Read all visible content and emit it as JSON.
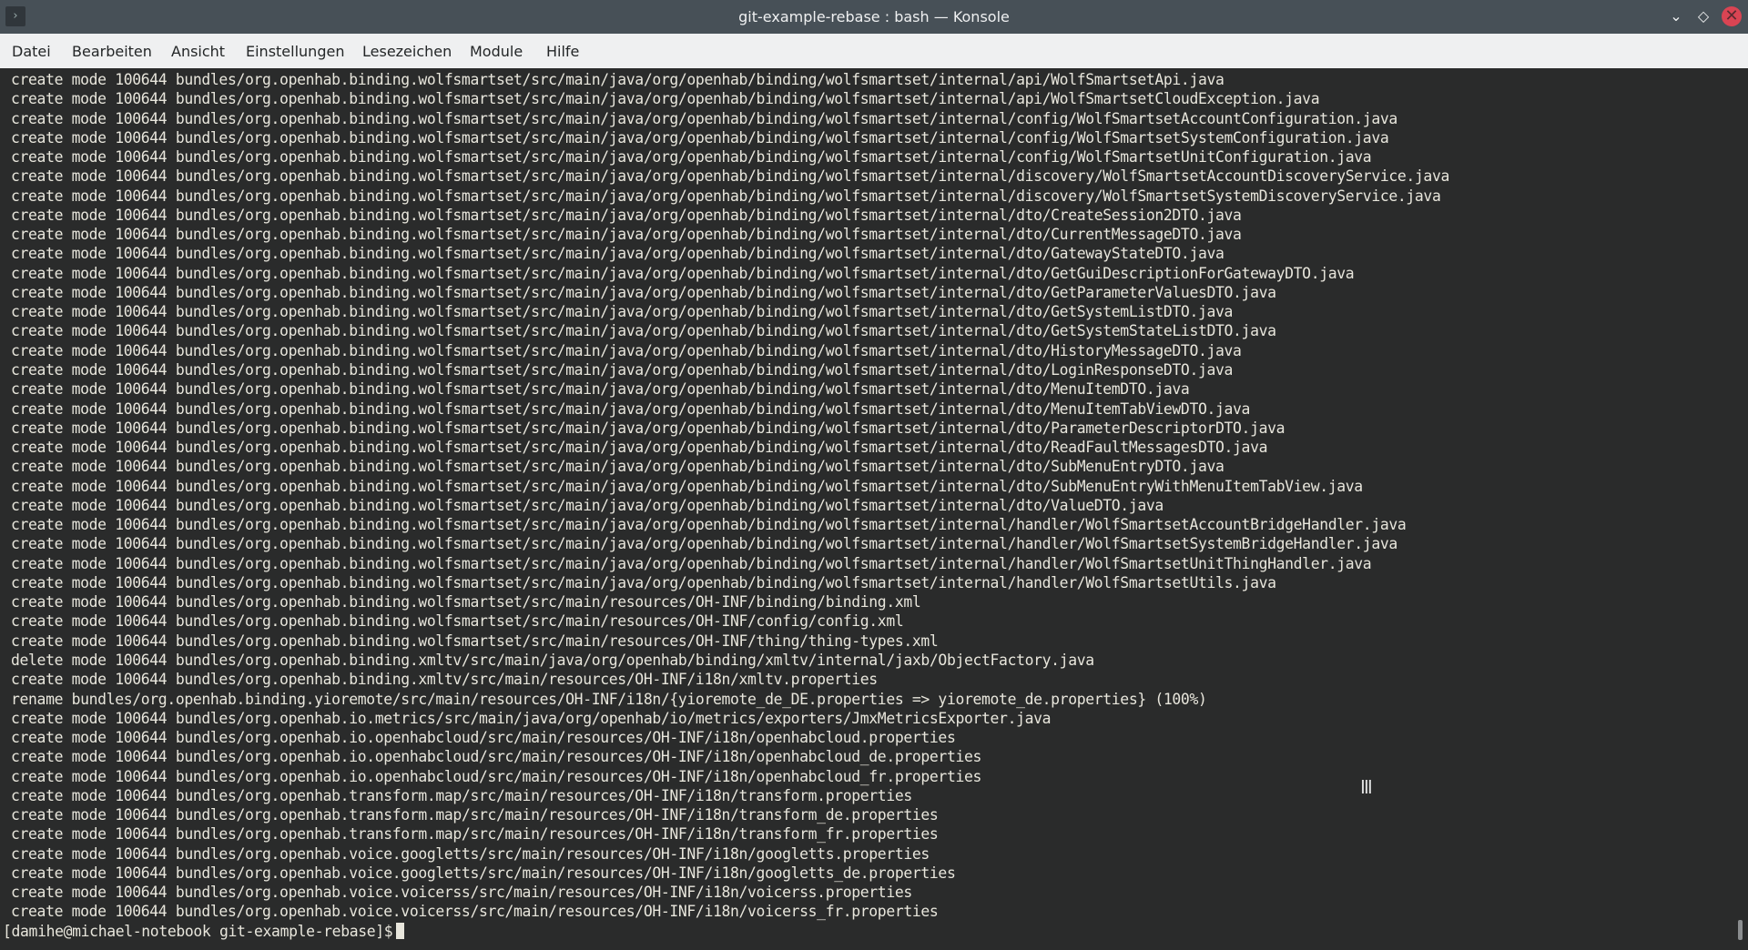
{
  "window": {
    "title": "git-example-rebase : bash — Konsole",
    "minimize_icon": "chevron-down-icon",
    "maximize_icon": "diamond-icon",
    "close_icon": "close-icon"
  },
  "menu": [
    "Datei",
    "Bearbeiten",
    "Ansicht",
    "Einstellungen",
    "Lesezeichen",
    "Module",
    "Hilfe"
  ],
  "terminal": {
    "lines": [
      "create mode 100644 bundles/org.openhab.binding.wolfsmartset/src/main/java/org/openhab/binding/wolfsmartset/internal/api/WolfSmartsetApi.java",
      "create mode 100644 bundles/org.openhab.binding.wolfsmartset/src/main/java/org/openhab/binding/wolfsmartset/internal/api/WolfSmartsetCloudException.java",
      "create mode 100644 bundles/org.openhab.binding.wolfsmartset/src/main/java/org/openhab/binding/wolfsmartset/internal/config/WolfSmartsetAccountConfiguration.java",
      "create mode 100644 bundles/org.openhab.binding.wolfsmartset/src/main/java/org/openhab/binding/wolfsmartset/internal/config/WolfSmartsetSystemConfiguration.java",
      "create mode 100644 bundles/org.openhab.binding.wolfsmartset/src/main/java/org/openhab/binding/wolfsmartset/internal/config/WolfSmartsetUnitConfiguration.java",
      "create mode 100644 bundles/org.openhab.binding.wolfsmartset/src/main/java/org/openhab/binding/wolfsmartset/internal/discovery/WolfSmartsetAccountDiscoveryService.java",
      "create mode 100644 bundles/org.openhab.binding.wolfsmartset/src/main/java/org/openhab/binding/wolfsmartset/internal/discovery/WolfSmartsetSystemDiscoveryService.java",
      "create mode 100644 bundles/org.openhab.binding.wolfsmartset/src/main/java/org/openhab/binding/wolfsmartset/internal/dto/CreateSession2DTO.java",
      "create mode 100644 bundles/org.openhab.binding.wolfsmartset/src/main/java/org/openhab/binding/wolfsmartset/internal/dto/CurrentMessageDTO.java",
      "create mode 100644 bundles/org.openhab.binding.wolfsmartset/src/main/java/org/openhab/binding/wolfsmartset/internal/dto/GatewayStateDTO.java",
      "create mode 100644 bundles/org.openhab.binding.wolfsmartset/src/main/java/org/openhab/binding/wolfsmartset/internal/dto/GetGuiDescriptionForGatewayDTO.java",
      "create mode 100644 bundles/org.openhab.binding.wolfsmartset/src/main/java/org/openhab/binding/wolfsmartset/internal/dto/GetParameterValuesDTO.java",
      "create mode 100644 bundles/org.openhab.binding.wolfsmartset/src/main/java/org/openhab/binding/wolfsmartset/internal/dto/GetSystemListDTO.java",
      "create mode 100644 bundles/org.openhab.binding.wolfsmartset/src/main/java/org/openhab/binding/wolfsmartset/internal/dto/GetSystemStateListDTO.java",
      "create mode 100644 bundles/org.openhab.binding.wolfsmartset/src/main/java/org/openhab/binding/wolfsmartset/internal/dto/HistoryMessageDTO.java",
      "create mode 100644 bundles/org.openhab.binding.wolfsmartset/src/main/java/org/openhab/binding/wolfsmartset/internal/dto/LoginResponseDTO.java",
      "create mode 100644 bundles/org.openhab.binding.wolfsmartset/src/main/java/org/openhab/binding/wolfsmartset/internal/dto/MenuItemDTO.java",
      "create mode 100644 bundles/org.openhab.binding.wolfsmartset/src/main/java/org/openhab/binding/wolfsmartset/internal/dto/MenuItemTabViewDTO.java",
      "create mode 100644 bundles/org.openhab.binding.wolfsmartset/src/main/java/org/openhab/binding/wolfsmartset/internal/dto/ParameterDescriptorDTO.java",
      "create mode 100644 bundles/org.openhab.binding.wolfsmartset/src/main/java/org/openhab/binding/wolfsmartset/internal/dto/ReadFaultMessagesDTO.java",
      "create mode 100644 bundles/org.openhab.binding.wolfsmartset/src/main/java/org/openhab/binding/wolfsmartset/internal/dto/SubMenuEntryDTO.java",
      "create mode 100644 bundles/org.openhab.binding.wolfsmartset/src/main/java/org/openhab/binding/wolfsmartset/internal/dto/SubMenuEntryWithMenuItemTabView.java",
      "create mode 100644 bundles/org.openhab.binding.wolfsmartset/src/main/java/org/openhab/binding/wolfsmartset/internal/dto/ValueDTO.java",
      "create mode 100644 bundles/org.openhab.binding.wolfsmartset/src/main/java/org/openhab/binding/wolfsmartset/internal/handler/WolfSmartsetAccountBridgeHandler.java",
      "create mode 100644 bundles/org.openhab.binding.wolfsmartset/src/main/java/org/openhab/binding/wolfsmartset/internal/handler/WolfSmartsetSystemBridgeHandler.java",
      "create mode 100644 bundles/org.openhab.binding.wolfsmartset/src/main/java/org/openhab/binding/wolfsmartset/internal/handler/WolfSmartsetUnitThingHandler.java",
      "create mode 100644 bundles/org.openhab.binding.wolfsmartset/src/main/java/org/openhab/binding/wolfsmartset/internal/handler/WolfSmartsetUtils.java",
      "create mode 100644 bundles/org.openhab.binding.wolfsmartset/src/main/resources/OH-INF/binding/binding.xml",
      "create mode 100644 bundles/org.openhab.binding.wolfsmartset/src/main/resources/OH-INF/config/config.xml",
      "create mode 100644 bundles/org.openhab.binding.wolfsmartset/src/main/resources/OH-INF/thing/thing-types.xml",
      "delete mode 100644 bundles/org.openhab.binding.xmltv/src/main/java/org/openhab/binding/xmltv/internal/jaxb/ObjectFactory.java",
      "create mode 100644 bundles/org.openhab.binding.xmltv/src/main/resources/OH-INF/i18n/xmltv.properties",
      "rename bundles/org.openhab.binding.yioremote/src/main/resources/OH-INF/i18n/{yioremote_de_DE.properties => yioremote_de.properties} (100%)",
      "create mode 100644 bundles/org.openhab.io.metrics/src/main/java/org/openhab/io/metrics/exporters/JmxMetricsExporter.java",
      "create mode 100644 bundles/org.openhab.io.openhabcloud/src/main/resources/OH-INF/i18n/openhabcloud.properties",
      "create mode 100644 bundles/org.openhab.io.openhabcloud/src/main/resources/OH-INF/i18n/openhabcloud_de.properties",
      "create mode 100644 bundles/org.openhab.io.openhabcloud/src/main/resources/OH-INF/i18n/openhabcloud_fr.properties",
      "create mode 100644 bundles/org.openhab.transform.map/src/main/resources/OH-INF/i18n/transform.properties",
      "create mode 100644 bundles/org.openhab.transform.map/src/main/resources/OH-INF/i18n/transform_de.properties",
      "create mode 100644 bundles/org.openhab.transform.map/src/main/resources/OH-INF/i18n/transform_fr.properties",
      "create mode 100644 bundles/org.openhab.voice.googletts/src/main/resources/OH-INF/i18n/googletts.properties",
      "create mode 100644 bundles/org.openhab.voice.googletts/src/main/resources/OH-INF/i18n/googletts_de.properties",
      "create mode 100644 bundles/org.openhab.voice.voicerss/src/main/resources/OH-INF/i18n/voicerss.properties",
      "create mode 100644 bundles/org.openhab.voice.voicerss/src/main/resources/OH-INF/i18n/voicerss_fr.properties"
    ],
    "prompt": "[damihe@michael-notebook git-example-rebase]$"
  }
}
